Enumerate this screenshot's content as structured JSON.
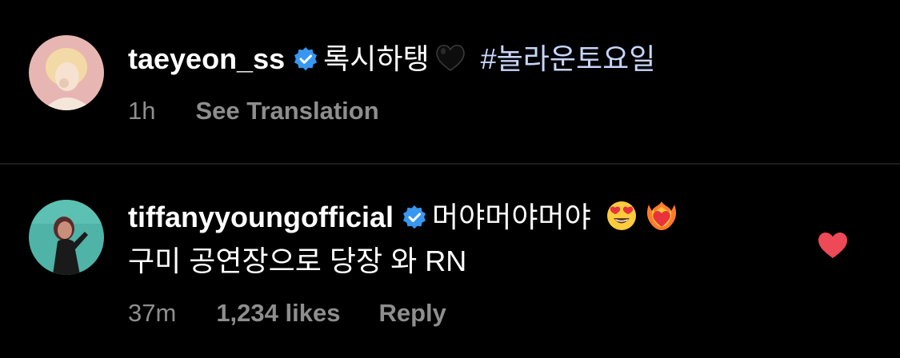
{
  "comments": [
    {
      "username": "taeyeon_ss",
      "verified": true,
      "text": "록시하탱",
      "emoji": "black-heart",
      "hashtag": "#놀라운토요일",
      "time": "1h",
      "actions": [
        "See Translation"
      ]
    },
    {
      "username": "tiffanyyoungofficial",
      "verified": true,
      "text_line1": "머야머야머야",
      "emojis": [
        "heart-eyes",
        "heart-on-fire"
      ],
      "text_line2": "구미 공연장으로 당장 와 RN",
      "time": "37m",
      "likes": "1,234 likes",
      "reply": "Reply",
      "liked": true
    }
  ],
  "colors": {
    "background": "#000000",
    "text": "#ffffff",
    "meta": "#8e8e8e",
    "hashtag": "#c7d5fa",
    "verified": "#3897f0",
    "like": "#ed4956"
  }
}
